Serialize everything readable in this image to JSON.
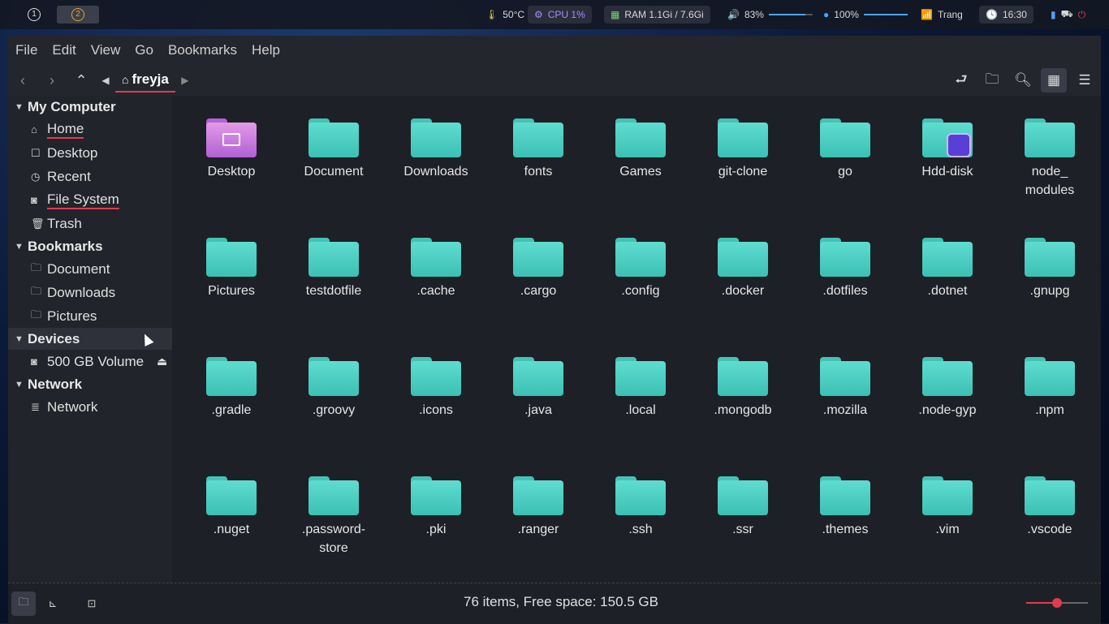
{
  "topbar": {
    "workspaces": [
      "1",
      "2"
    ],
    "temp": "50°C",
    "cpu": "CPU 1%",
    "ram": "RAM 1.1Gi / 7.6Gi",
    "volume": "83%",
    "volume_level": 0.83,
    "brightness": "100%",
    "brightness_level": 1.0,
    "wifi": "Trang",
    "clock": "16:30"
  },
  "menubar": [
    "File",
    "Edit",
    "View",
    "Go",
    "Bookmarks",
    "Help"
  ],
  "toolbar": {
    "location": "freyja"
  },
  "sidebar": {
    "my_computer": {
      "title": "My Computer",
      "items": [
        {
          "label": "Home",
          "icon": "home-icon"
        },
        {
          "label": "Desktop",
          "icon": "desktop-icon"
        },
        {
          "label": "Recent",
          "icon": "clock-icon"
        },
        {
          "label": "File System",
          "icon": "drive-icon"
        },
        {
          "label": "Trash",
          "icon": "trash-icon"
        }
      ]
    },
    "bookmarks": {
      "title": "Bookmarks",
      "items": [
        {
          "label": "Document",
          "icon": "folder-icon"
        },
        {
          "label": "Downloads",
          "icon": "folder-icon"
        },
        {
          "label": "Pictures",
          "icon": "folder-icon"
        }
      ]
    },
    "devices": {
      "title": "Devices",
      "items": [
        {
          "label": "500 GB Volume",
          "icon": "drive-icon"
        }
      ]
    },
    "network": {
      "title": "Network",
      "items": [
        {
          "label": "Network",
          "icon": "network-icon"
        }
      ]
    }
  },
  "files": [
    "Desktop",
    "Document",
    "Downloads",
    "fonts",
    "Games",
    "git-clone",
    "go",
    "Hdd-disk",
    "node_\nmodules",
    "Pictures",
    "testdotfile",
    ".cache",
    ".cargo",
    ".config",
    ".docker",
    ".dotfiles",
    ".dotnet",
    ".gnupg",
    ".gradle",
    ".groovy",
    ".icons",
    ".java",
    ".local",
    ".mongodb",
    ".mozilla",
    ".node-gyp",
    ".npm",
    ".nuget",
    ".password-\nstore",
    ".pki",
    ".ranger",
    ".ssh",
    ".ssr",
    ".themes",
    ".vim",
    ".vscode"
  ],
  "status": {
    "text": "76 items, Free space: 150.5 GB",
    "zoom_level": 0.5
  },
  "colors": {
    "folder": "#4fd1c5",
    "accent": "#e23b4e",
    "desktop_folder": "#c77ddf"
  }
}
